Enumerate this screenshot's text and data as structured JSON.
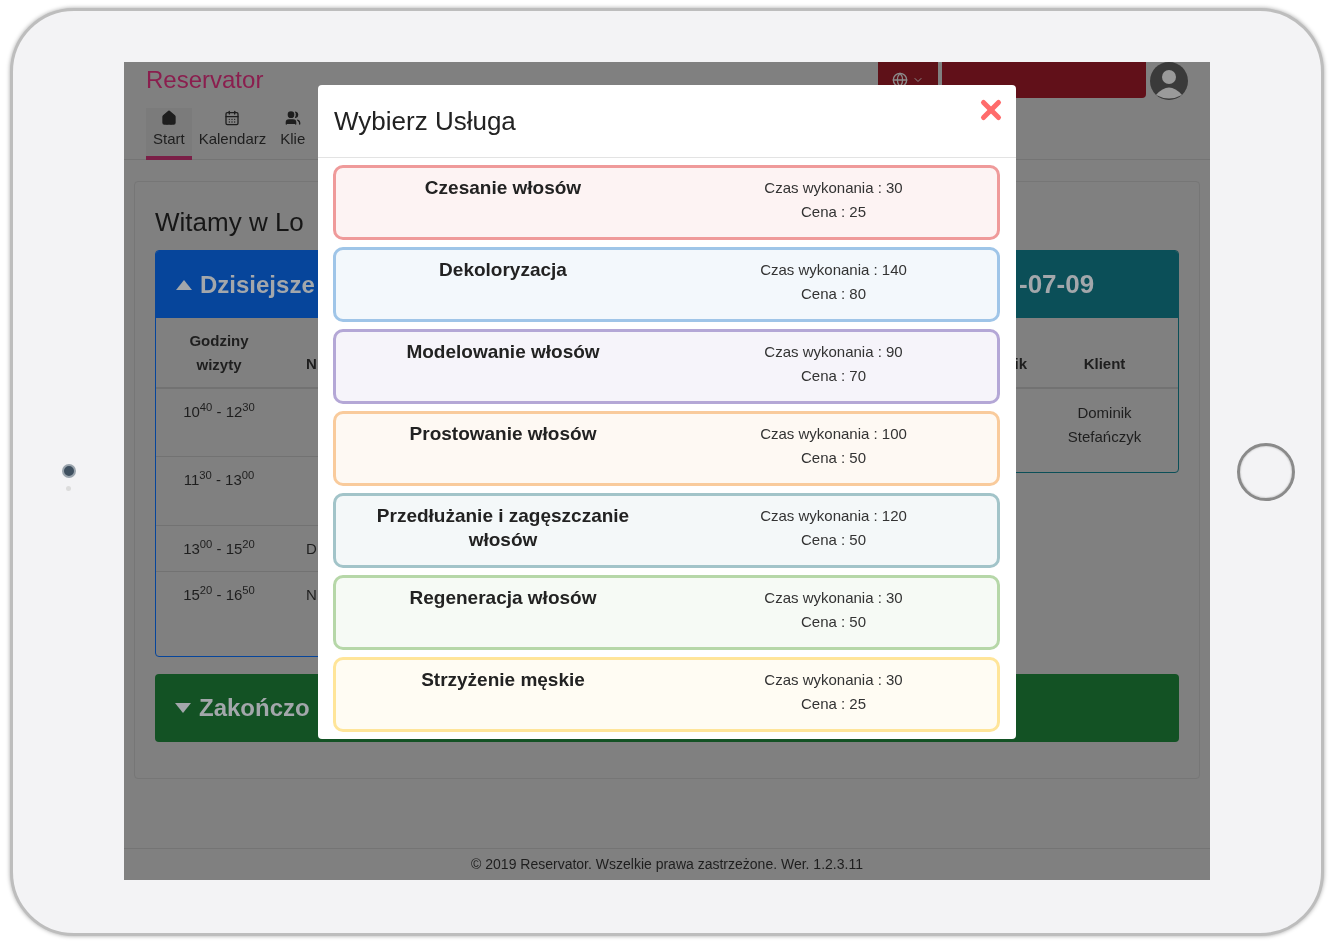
{
  "header": {
    "brand": "Reservator",
    "nav": [
      {
        "label": "Start",
        "kind": "home",
        "selected": true
      },
      {
        "label": "Kalendarz",
        "kind": "calendar",
        "selected": false
      },
      {
        "label": "Klie",
        "kind": "users",
        "selected": false
      }
    ]
  },
  "page": {
    "title": "Witamy w Lo",
    "today_panel": {
      "title": "Dzisiejsze",
      "expanded": true,
      "columns": [
        "Godziny wizyty",
        "N"
      ],
      "rows": [
        {
          "time": "10$^{40}$ - 12$^{30}$"
        },
        {
          "time": "11$^{30}$ - 13$^{00}$"
        },
        {
          "time": "13$^{00}$ - 15$^{20}$",
          "column_2": "D"
        },
        {
          "time": "15$^{20}$ - 16$^{50}$",
          "column_2": "N"
        }
      ]
    },
    "date_panel": {
      "title": "-07-09",
      "columns": [
        "ik",
        "Klient"
      ],
      "rows": [
        {
          "client": "Dominik Stefańczyk"
        }
      ]
    },
    "finished_panel": {
      "title": "Zakończo",
      "expanded": false
    }
  },
  "footer": "© 2019 Reservator. Wszelkie prawa zastrzeżone. Wer. 1.2.3.11",
  "modal": {
    "title": "Wybierz Usługa",
    "services": [
      {
        "name": "Czesanie włosów",
        "duration": "Czas wykonania : 30",
        "price": "Cena : 25",
        "color": "#ef9a9a"
      },
      {
        "name": "Dekoloryzacja",
        "duration": "Czas wykonania : 140",
        "price": "Cena : 80",
        "color": "#9fc5e8"
      },
      {
        "name": "Modelowanie włosów",
        "duration": "Czas wykonania : 90",
        "price": "Cena : 70",
        "color": "#b4a7d6"
      },
      {
        "name": "Prostowanie włosów",
        "duration": "Czas wykonania : 100",
        "price": "Cena : 50",
        "color": "#f9cb9c"
      },
      {
        "name": "Przedłużanie i zagęszczanie włosów",
        "duration": "Czas wykonania : 120",
        "price": "Cena : 50",
        "color": "#a2c4c9"
      },
      {
        "name": "Regeneracja włosów",
        "duration": "Czas wykonania : 30",
        "price": "Cena : 50",
        "color": "#b6d7a8"
      },
      {
        "name": "Strzyżenie męskie",
        "duration": "Czas wykonania : 30",
        "price": "Cena : 25",
        "color": "#ffe599"
      }
    ]
  }
}
